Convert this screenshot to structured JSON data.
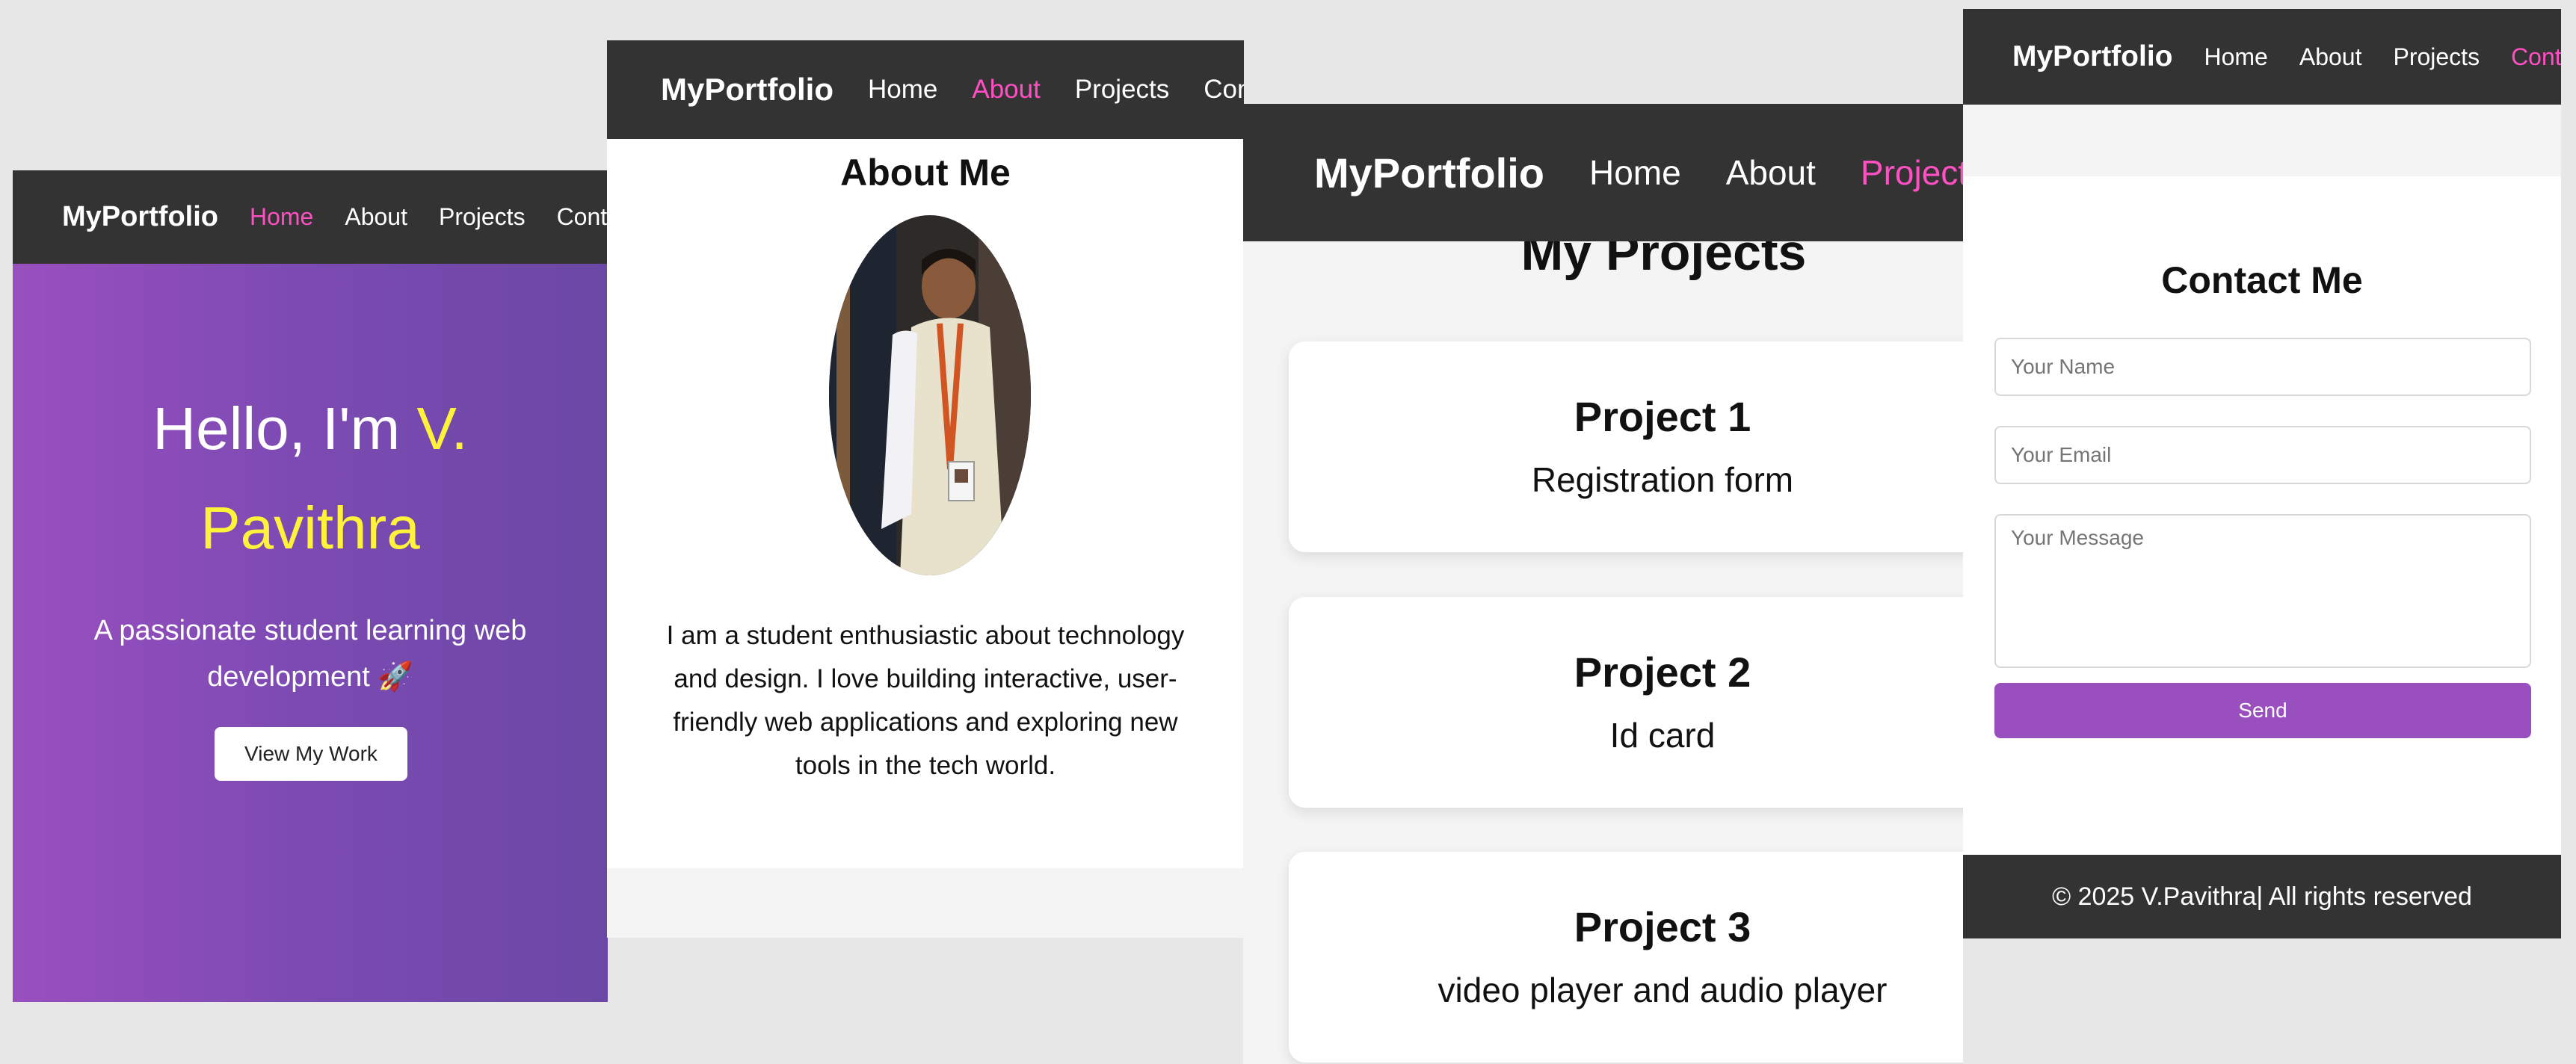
{
  "brand": "MyPortfolio",
  "nav_links": [
    "Home",
    "About",
    "Projects",
    "Contact"
  ],
  "colors": {
    "nav_bg": "#333333",
    "active_link": "#ff4fc3",
    "highlight": "#fff23a",
    "accent": "#9a4fbf"
  },
  "home": {
    "greeting": "Hello, I'm",
    "name_part1": "V.",
    "name_part2": "Pavithra",
    "subtitle": "A passionate student learning web development 🚀",
    "button": "View My Work"
  },
  "about": {
    "title": "About Me",
    "text": "I am a student enthusiastic about technology and design. I love building interactive, user-friendly web applications and exploring new tools in the tech world."
  },
  "projects": {
    "title": "My Projects",
    "items": [
      {
        "title": "Project 1",
        "desc": "Registration form"
      },
      {
        "title": "Project 2",
        "desc": "Id card"
      },
      {
        "title": "Project 3",
        "desc": "video player and audio player"
      }
    ]
  },
  "contact": {
    "title": "Contact Me",
    "name_placeholder": "Your Name",
    "email_placeholder": "Your Email",
    "message_placeholder": "Your Message",
    "send": "Send",
    "footer": "© 2025 V.Pavithra| All rights reserved"
  }
}
